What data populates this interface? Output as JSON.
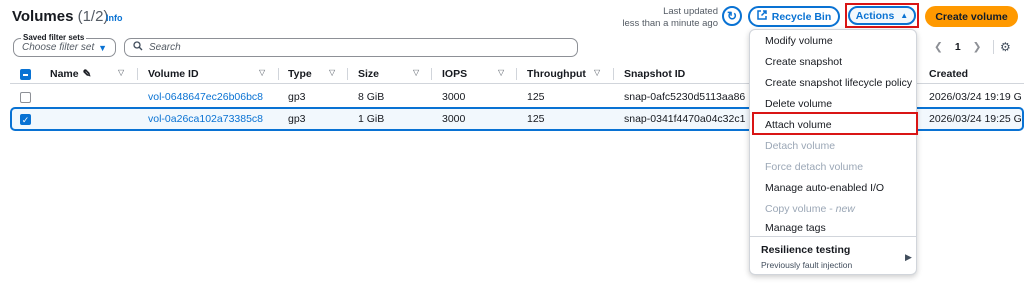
{
  "header": {
    "title": "Volumes",
    "count": "(1/2)",
    "info": "Info",
    "last_updated_label": "Last updated",
    "last_updated_value": "less than a minute ago",
    "recycle_bin": "Recycle Bin",
    "actions": "Actions",
    "create_volume": "Create volume"
  },
  "filters": {
    "saved_label": "Saved filter sets",
    "saved_placeholder": "Choose filter set",
    "search_placeholder": "Search"
  },
  "pager": {
    "page": "1"
  },
  "columns": [
    "Name",
    "Volume ID",
    "Type",
    "Size",
    "IOPS",
    "Throughput",
    "Snapshot ID",
    "Created"
  ],
  "rows": [
    {
      "name": "",
      "volume_id": "vol-0648647ec26b06bc8",
      "type": "gp3",
      "size": "8 GiB",
      "iops": "3000",
      "throughput": "125",
      "snapshot_id": "snap-0afc5230d5113aa86",
      "created": "2026/03/24 19:19 G",
      "selected": false
    },
    {
      "name": "",
      "volume_id": "vol-0a26ca102a73385c8",
      "type": "gp3",
      "size": "1 GiB",
      "iops": "3000",
      "throughput": "125",
      "snapshot_id": "snap-0341f4470a04c32c1",
      "created": "2026/03/24 19:25 G",
      "selected": true
    }
  ],
  "menu": {
    "items": [
      {
        "label": "Modify volume",
        "disabled": false
      },
      {
        "label": "Create snapshot",
        "disabled": false
      },
      {
        "label": "Create snapshot lifecycle policy",
        "disabled": false
      },
      {
        "label": "Delete volume",
        "disabled": false
      },
      {
        "label": "Attach volume",
        "disabled": false
      },
      {
        "label": "Detach volume",
        "disabled": true
      },
      {
        "label": "Force detach volume",
        "disabled": true
      },
      {
        "label": "Manage auto-enabled I/O",
        "disabled": false
      },
      {
        "label": "Copy volume",
        "suffix": "new",
        "disabled": true
      },
      {
        "label": "Manage tags",
        "disabled": false
      }
    ],
    "resilience_title": "Resilience testing",
    "resilience_sub": "Previously fault injection"
  },
  "colors": {
    "accent": "#0972d3",
    "primary_button": "#ff9900",
    "highlight": "#d91515"
  }
}
